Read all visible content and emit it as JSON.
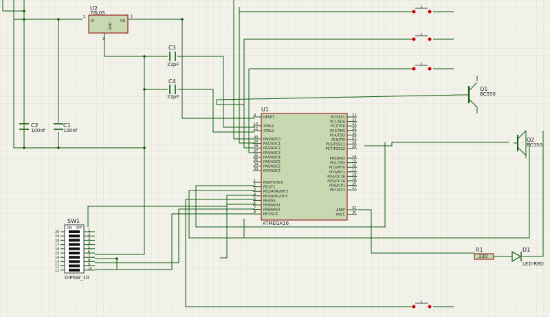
{
  "colors": {
    "background": "#f2f2ea",
    "grid": "#d6d6cc",
    "grid_major": "#c4c4b8",
    "wire": "#0a5a0a",
    "body": "#c8d8b0",
    "body_stroke": "#8b0000",
    "pin_dot": "#cc0000",
    "text": "#222222"
  },
  "components": {
    "u2": {
      "ref": "U2",
      "value": "78L05",
      "pin_vi": "VI",
      "pin_vo": "VO",
      "pin_gnd": "GND",
      "pin_num_in": "3",
      "pin_num_out": "1",
      "pin_num_gnd": "2"
    },
    "c1": {
      "ref": "C1",
      "value": "100nf"
    },
    "c2": {
      "ref": "C2",
      "value": "100nf"
    },
    "c3": {
      "ref": "C3",
      "value": "22pF"
    },
    "c4": {
      "ref": "C4",
      "value": "22pF"
    },
    "q1": {
      "ref": "Q1",
      "value": "BC550"
    },
    "q2": {
      "ref": "Q2",
      "value": "BC550"
    },
    "r1": {
      "ref": "R1",
      "value": "330"
    },
    "d1": {
      "ref": "D1",
      "value": "LED-RED"
    },
    "sw1": {
      "ref": "SW1",
      "value": "DIPSW_10",
      "head_on": "ON",
      "head_off": "OFF",
      "left_pins": [
        "20",
        "19",
        "18",
        "17",
        "16",
        "15",
        "14",
        "13",
        "12",
        "11"
      ],
      "right_pins": [
        "1",
        "2",
        "3",
        "4",
        "5",
        "6",
        "7",
        "8",
        "9",
        "10"
      ]
    },
    "u1": {
      "ref": "U1",
      "value": "ATMEGA16",
      "left_pins": [
        {
          "num": "9",
          "name": "RESET"
        },
        {
          "num": "13",
          "name": "XTAL1"
        },
        {
          "num": "12",
          "name": "XTAL2"
        },
        {
          "num": "40",
          "name": "PA0/ADC0"
        },
        {
          "num": "39",
          "name": "PA1/ADC1"
        },
        {
          "num": "38",
          "name": "PA2/ADC2"
        },
        {
          "num": "37",
          "name": "PA3/ADC3"
        },
        {
          "num": "36",
          "name": "PA4/ADC4"
        },
        {
          "num": "35",
          "name": "PA5/ADC5"
        },
        {
          "num": "34",
          "name": "PA6/ADC6"
        },
        {
          "num": "33",
          "name": "PA7/ADC7"
        },
        {
          "num": "1",
          "name": "PB0/T0/XCK"
        },
        {
          "num": "2",
          "name": "PB1/T1"
        },
        {
          "num": "3",
          "name": "PB2/AIN0/INT2"
        },
        {
          "num": "4",
          "name": "PB3/AIN1/OC0"
        },
        {
          "num": "5",
          "name": "PB4/SS"
        },
        {
          "num": "6",
          "name": "PB5/MOSI"
        },
        {
          "num": "7",
          "name": "PB6/MISO"
        },
        {
          "num": "8",
          "name": "PB7/SCK"
        }
      ],
      "right_pins": [
        {
          "num": "22",
          "name": "PC0/SCL"
        },
        {
          "num": "23",
          "name": "PC1/SDA"
        },
        {
          "num": "24",
          "name": "PC2/TCK"
        },
        {
          "num": "25",
          "name": "PC3/TMS"
        },
        {
          "num": "26",
          "name": "PC4/TDO"
        },
        {
          "num": "27",
          "name": "PC5/TDI"
        },
        {
          "num": "28",
          "name": "PC6/TOSC1"
        },
        {
          "num": "29",
          "name": "PC7/TOSC2"
        },
        {
          "num": "14",
          "name": "PD0/RXD"
        },
        {
          "num": "15",
          "name": "PD1/TXD"
        },
        {
          "num": "16",
          "name": "PD2/INT0"
        },
        {
          "num": "17",
          "name": "PD3/INT1"
        },
        {
          "num": "18",
          "name": "PD4/OC1B"
        },
        {
          "num": "19",
          "name": "PD5/OC1A"
        },
        {
          "num": "20",
          "name": "PD6/ICP1"
        },
        {
          "num": "21",
          "name": "PD7/OC2"
        },
        {
          "num": "32",
          "name": "AREF"
        },
        {
          "num": "30",
          "name": "AVCC"
        }
      ]
    }
  }
}
